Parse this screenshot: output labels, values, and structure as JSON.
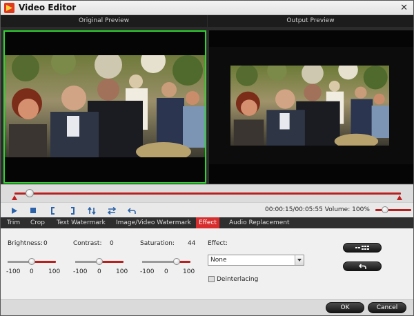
{
  "window": {
    "title": "Video Editor"
  },
  "icons": {
    "app": "app-logo-icon",
    "close": "close-icon",
    "play": "play-icon",
    "stop": "stop-icon",
    "trim_start": "bracket-left-icon",
    "trim_end": "bracket-right-icon",
    "split": "split-arrows-icon",
    "swap": "swap-arrows-icon",
    "reset": "undo-arrow-icon",
    "effect_options": "grid-menu-icon",
    "effect_reset": "undo-arrow-icon"
  },
  "previews": {
    "original_label": "Original Preview",
    "output_label": "Output Preview"
  },
  "timeline": {
    "position": 0.04
  },
  "playback": {
    "time": "00:00:15/00:05:55",
    "volume_label": "Volume:",
    "volume_value": "100%"
  },
  "tabs": [
    {
      "label": "Trim",
      "active": false
    },
    {
      "label": "Crop",
      "active": false
    },
    {
      "label": "Text Watermark",
      "active": false
    },
    {
      "label": "Image/Video Watermark",
      "active": false
    },
    {
      "label": "Effect",
      "active": true
    },
    {
      "label": "Audio Replacement",
      "active": false
    }
  ],
  "effect": {
    "brightness": {
      "label": "Brightness:",
      "value": "0",
      "min": "-100",
      "mid": "0",
      "max": "100",
      "level": 0
    },
    "contrast": {
      "label": "Contrast:",
      "value": "0",
      "min": "-100",
      "mid": "0",
      "max": "100",
      "level": 0
    },
    "saturation": {
      "label": "Saturation:",
      "value": "44",
      "min": "-100",
      "mid": "0",
      "max": "100",
      "level": 44
    },
    "effect_label": "Effect:",
    "effect_selected": "None",
    "deinterlacing_label": "Deinterlacing",
    "deinterlacing_checked": false
  },
  "footer": {
    "ok_label": "OK",
    "cancel_label": "Cancel"
  },
  "colors": {
    "accent_red": "#d62e2e",
    "selection_green": "#2fd42f",
    "control_blue": "#2c63a8"
  }
}
